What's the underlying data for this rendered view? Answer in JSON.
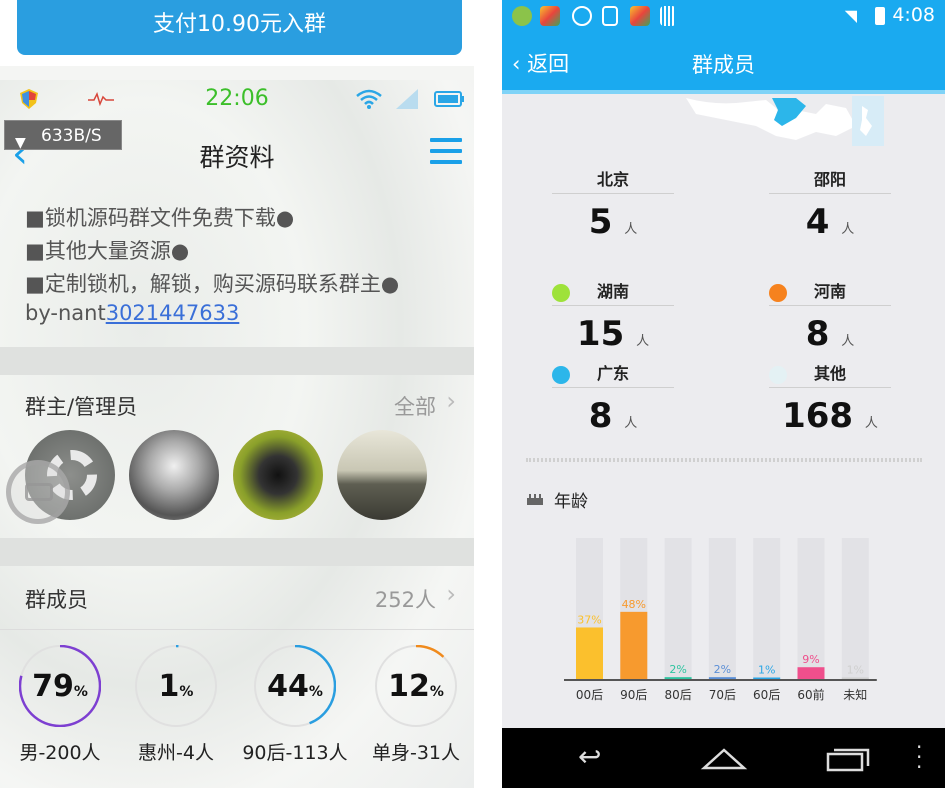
{
  "left": {
    "pay_button": "支付10.90元入群",
    "status_time": "22:06",
    "net_speed": "633B/S",
    "title": "群资料",
    "desc_lines": [
      "■锁机源码群文件免费下载●",
      "■其他大量资源●",
      "■定制锁机，解锁，购买源码联系群主●"
    ],
    "byline_prefix": "by-nant",
    "byline_link": "3021447633",
    "admins": {
      "label": "群主/管理员",
      "value": "全部"
    },
    "members": {
      "label": "群成员",
      "value": "252人"
    },
    "stats": [
      {
        "value": "79",
        "unit": "%",
        "label": "男-200人",
        "fraction": 0.79,
        "color": "#7d3fd1"
      },
      {
        "value": "1",
        "unit": "%",
        "label": "惠州-4人",
        "fraction": 0.01,
        "color": "#2a9ee0"
      },
      {
        "value": "44",
        "unit": "%",
        "label": "90后-113人",
        "fraction": 0.44,
        "color": "#2a9ee0"
      },
      {
        "value": "12",
        "unit": "%",
        "label": "单身-31人",
        "fraction": 0.12,
        "color": "#f08a1c"
      }
    ]
  },
  "right": {
    "status_time": "4:08",
    "back_label": "返回",
    "title": "群成员",
    "cities": [
      {
        "name": "北京",
        "value": "5",
        "unit": "人",
        "dot": ""
      },
      {
        "name": "邵阳",
        "value": "4",
        "unit": "人",
        "dot": ""
      },
      {
        "name": "湖南",
        "value": "15",
        "unit": "人",
        "dot": "#9ee23a"
      },
      {
        "name": "河南",
        "value": "8",
        "unit": "人",
        "dot": "#f6821e"
      },
      {
        "name": "广东",
        "value": "8",
        "unit": "人",
        "dot": "#2cb6ea"
      },
      {
        "name": "其他",
        "value": "168",
        "unit": "人",
        "dot": "#e4f1f4"
      }
    ],
    "age_title": "年龄"
  },
  "chart_data": {
    "type": "bar",
    "title": "年龄",
    "categories": [
      "00后",
      "90后",
      "80后",
      "70后",
      "60后",
      "60前",
      "未知"
    ],
    "values": [
      37,
      48,
      2,
      2,
      1,
      9,
      1
    ],
    "labels": [
      "37%",
      "48%",
      "2%",
      "2%",
      "1%",
      "9%",
      "1%"
    ],
    "colors": [
      "#fbc02d",
      "#f79a2e",
      "#2ec4a0",
      "#5a8ed6",
      "#2aa6e6",
      "#ef4f8c",
      "#cfcfcf"
    ],
    "ylim": [
      0,
      100
    ],
    "grid": false
  }
}
